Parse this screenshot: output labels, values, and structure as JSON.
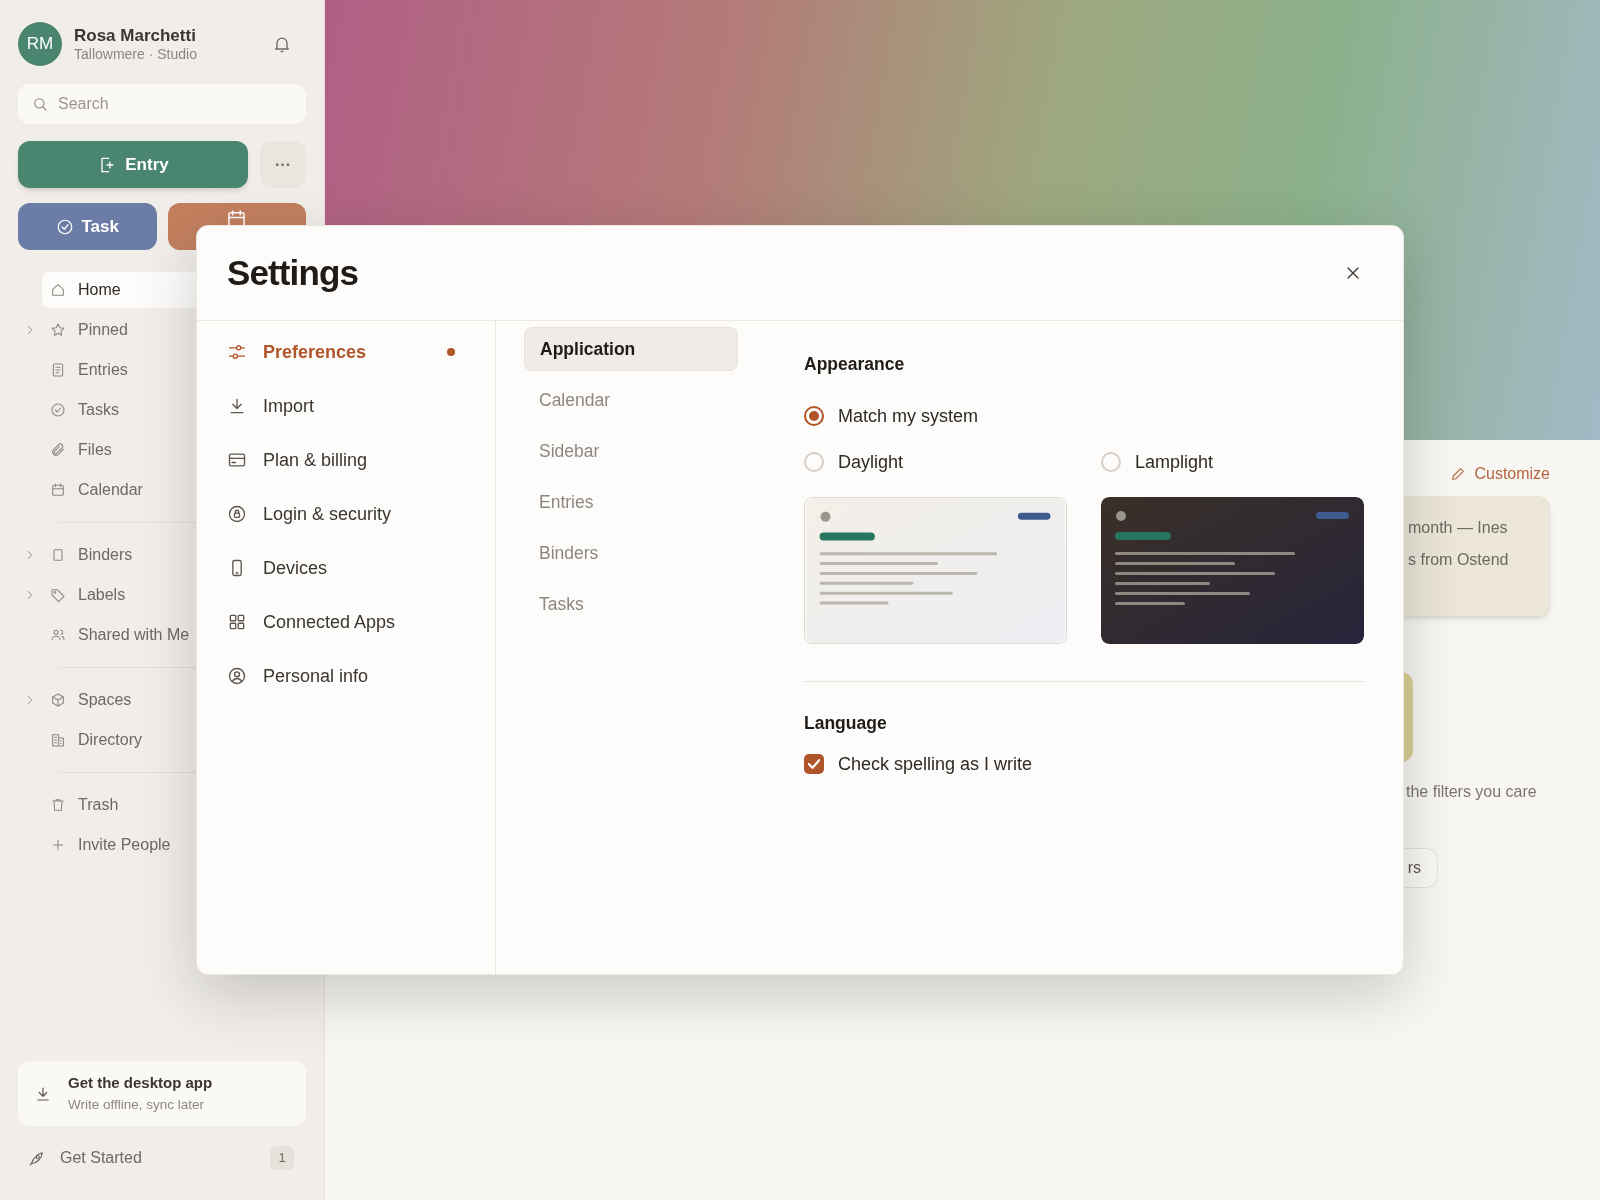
{
  "sidebar": {
    "user": {
      "initials": "RM",
      "name": "Rosa Marchetti",
      "subtitle": "Tallowmere · Studio"
    },
    "search": {
      "placeholder": "Search"
    },
    "primary_button": {
      "label": "Entry"
    },
    "more_button": {
      "label": "···"
    },
    "quick_buttons": [
      {
        "label": "Task",
        "color": "#6b7da6"
      },
      {
        "color": "#c27f5e"
      }
    ],
    "nav_groups": [
      [
        {
          "label": "Home",
          "selected": true,
          "expandable": false
        },
        {
          "label": "Pinned",
          "selected": false,
          "expandable": true
        },
        {
          "label": "Entries",
          "selected": false,
          "expandable": false
        },
        {
          "label": "Tasks",
          "selected": false,
          "expandable": false
        },
        {
          "label": "Files",
          "selected": false,
          "expandable": false
        },
        {
          "label": "Calendar",
          "selected": false,
          "expandable": false
        }
      ],
      [
        {
          "label": "Binders",
          "selected": false,
          "expandable": true
        },
        {
          "label": "Labels",
          "selected": false,
          "expandable": true
        },
        {
          "label": "Shared with Me",
          "selected": false,
          "expandable": false
        }
      ],
      [
        {
          "label": "Spaces",
          "selected": false,
          "expandable": true
        },
        {
          "label": "Directory",
          "selected": false,
          "expandable": false
        }
      ],
      [
        {
          "label": "Trash",
          "selected": false,
          "expandable": false
        },
        {
          "label": "Invite People",
          "selected": false,
          "expandable": false
        }
      ]
    ],
    "promo": {
      "title": "Get the desktop app",
      "subtitle": "Write offline, sync later"
    },
    "get_started": {
      "label": "Get Started",
      "count": "1"
    }
  },
  "background": {
    "customize": "Customize",
    "card_lines": [
      "month — Ines",
      "s from Ostend"
    ],
    "hint": "the filters you care",
    "button": "rs"
  },
  "settings": {
    "title": "Settings",
    "nav": [
      {
        "label": "Preferences",
        "selected": true,
        "dot": true
      },
      {
        "label": "Import",
        "selected": false,
        "dot": false
      },
      {
        "label": "Plan & billing",
        "selected": false,
        "dot": false
      },
      {
        "label": "Login & security",
        "selected": false,
        "dot": false
      },
      {
        "label": "Devices",
        "selected": false,
        "dot": false
      },
      {
        "label": "Connected Apps",
        "selected": false,
        "dot": false
      },
      {
        "label": "Personal info",
        "selected": false,
        "dot": false
      }
    ],
    "sections": [
      {
        "label": "Application",
        "selected": true
      },
      {
        "label": "Calendar",
        "selected": false
      },
      {
        "label": "Sidebar",
        "selected": false
      },
      {
        "label": "Entries",
        "selected": false
      },
      {
        "label": "Binders",
        "selected": false
      },
      {
        "label": "Tasks",
        "selected": false
      }
    ],
    "appearance": {
      "title": "Appearance",
      "options": [
        {
          "label": "Match my system",
          "selected": true
        },
        {
          "label": "Daylight",
          "selected": false
        },
        {
          "label": "Lamplight",
          "selected": false
        }
      ],
      "previews": [
        {
          "kind": "light"
        },
        {
          "kind": "dark"
        }
      ]
    },
    "language": {
      "title": "Language",
      "checkbox": {
        "label": "Check spelling as I write",
        "checked": true
      }
    }
  }
}
